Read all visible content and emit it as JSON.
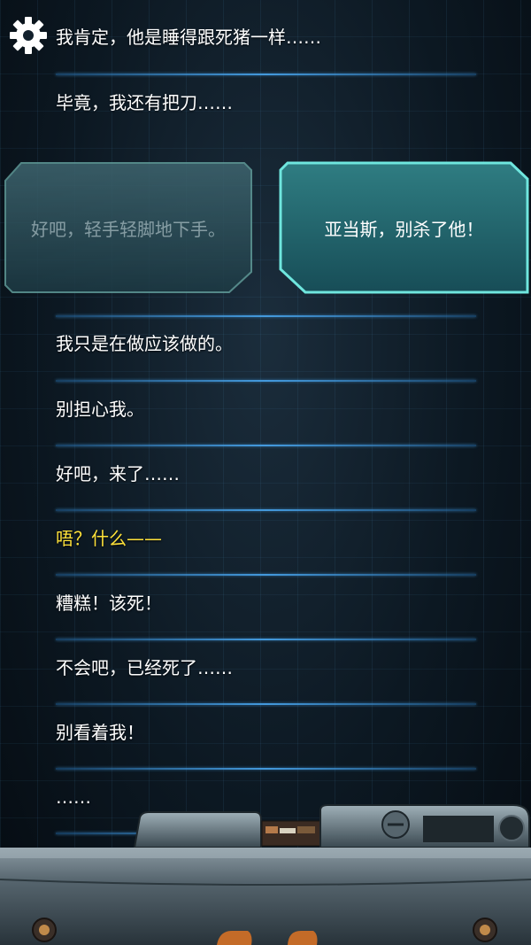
{
  "lines_top": [
    "我肯定，他是睡得跟死猪一样……",
    "毕竟，我还有把刀……"
  ],
  "choices": {
    "left": "好吧，轻手轻脚地下手。",
    "right": "亚当斯，别杀了他！"
  },
  "lines_bottom": [
    "我只是在做应该做的。",
    "别担心我。",
    "好吧，来了……",
    "唔？什么——",
    "糟糕！该死！",
    "不会吧，已经死了……",
    "别看着我！",
    "……"
  ],
  "colors": {
    "highlight_text": "#ffe23a",
    "choice_border": "#6fe6de",
    "divider": "#46a0e6"
  },
  "icons": {
    "settings": "gear-icon"
  }
}
